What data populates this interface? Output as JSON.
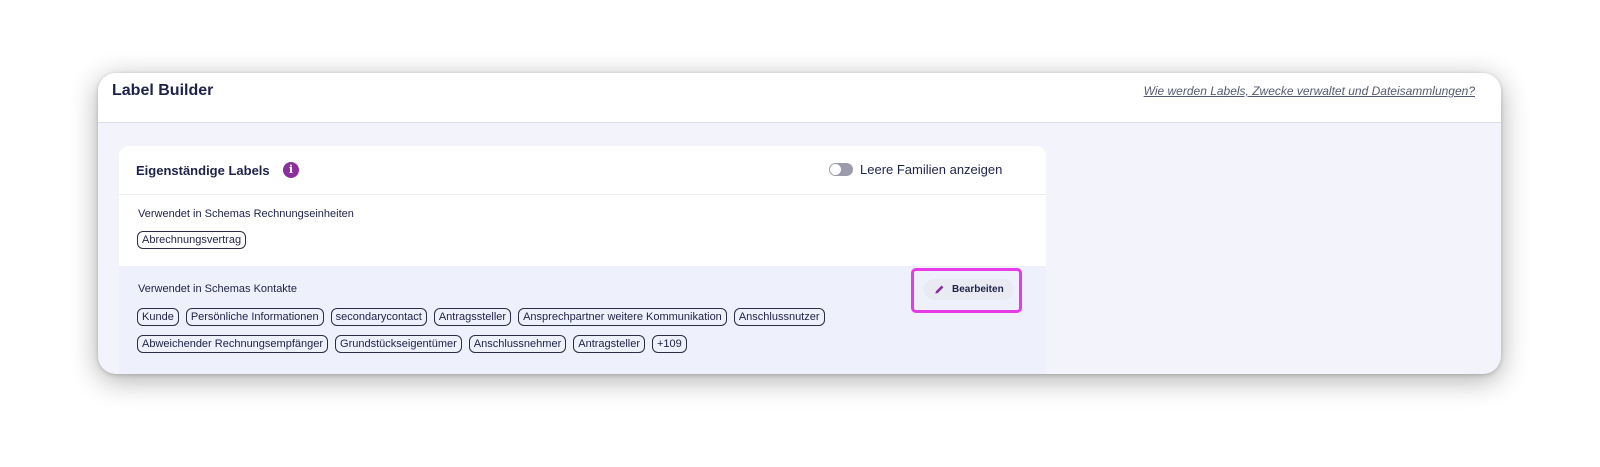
{
  "header": {
    "title": "Label Builder",
    "help_link": "Wie werden Labels, Zwecke verwaltet und Dateisammlungen?"
  },
  "card": {
    "title": "Eigenständige Labels",
    "info_icon": "info-icon",
    "toggle": {
      "label": "Leere Familien anzeigen",
      "on": false
    }
  },
  "sections": [
    {
      "title": "Verwendet in Schemas Rechnungseinheiten",
      "chips": [
        "Abrechnungsvertrag"
      ]
    },
    {
      "title": "Verwendet in Schemas Kontakte",
      "edit_label": "Bearbeiten",
      "edit_icon": "pencil-icon",
      "chips_row1": [
        "Kunde",
        "Persönliche Informationen",
        "secondarycontact",
        "Antragssteller",
        "Ansprechpartner weitere Kommunikation",
        "Anschlussnutzer"
      ],
      "chips_row2": [
        "Abweichender Rechnungsempfänger",
        "Grundstückseigentümer",
        "Anschlussnehmer",
        "Antragsteller",
        "+109"
      ]
    }
  ],
  "colors": {
    "accent": "#8b2f9e",
    "highlight": "#e83be8",
    "panel_bg": "#f3f4fb",
    "selected_section_bg": "#eef0fb"
  }
}
